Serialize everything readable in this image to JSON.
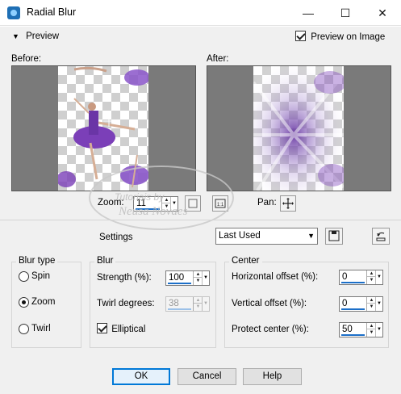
{
  "window": {
    "title": "Radial Blur",
    "minimize": "—",
    "maximize": "☐",
    "close": "✕"
  },
  "preview": {
    "toggle_label": "Preview",
    "preview_on_image_label": "Preview on Image",
    "preview_on_image_checked": true,
    "before_label": "Before:",
    "after_label": "After:"
  },
  "zoom": {
    "label": "Zoom:",
    "value": "11",
    "pan_label": "Pan:"
  },
  "watermark": {
    "line1": "Tutoriais by",
    "line2": "Neusa Novaes"
  },
  "settings": {
    "label": "Settings",
    "preset_value": "Last Used"
  },
  "blur_type": {
    "title": "Blur type",
    "options": [
      "Spin",
      "Zoom",
      "Twirl"
    ],
    "selected": "Zoom"
  },
  "blur": {
    "title": "Blur",
    "strength_label": "Strength (%):",
    "strength_value": "100",
    "twirl_label": "Twirl degrees:",
    "twirl_value": "38",
    "elliptical_label": "Elliptical",
    "elliptical_checked": true
  },
  "center": {
    "title": "Center",
    "horizontal_label": "Horizontal offset (%):",
    "horizontal_value": "0",
    "vertical_label": "Vertical offset (%):",
    "vertical_value": "0",
    "protect_label": "Protect center (%):",
    "protect_value": "50"
  },
  "buttons": {
    "ok": "OK",
    "cancel": "Cancel",
    "help": "Help"
  },
  "colors": {
    "accent": "#1c6fc8",
    "dancer_purple": "#7b3fb8"
  }
}
